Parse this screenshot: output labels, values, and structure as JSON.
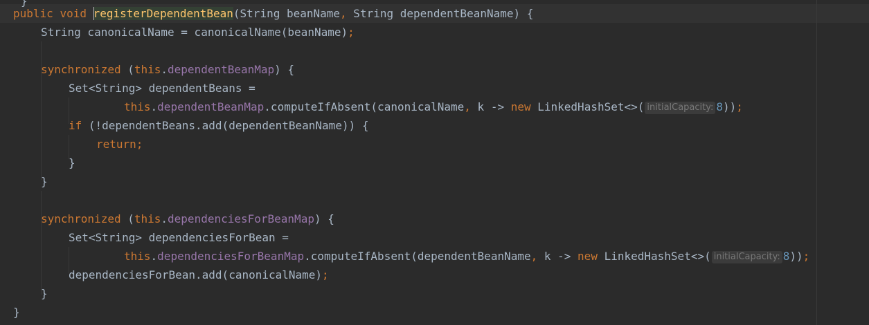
{
  "editor": {
    "top_fragment": "}",
    "line1": {
      "kw_public": "public",
      "kw_void": "void",
      "method_name": "registerDependentBean",
      "params": "(String beanName",
      "comma": ",",
      "params2": " String dependentBeanName) {"
    },
    "line2": {
      "text": "String canonicalName = canonicalName(beanName)",
      "semi": ";"
    },
    "line4": {
      "kw_sync": "synchronized",
      "open": " (",
      "kw_this": "this",
      "dot": ".",
      "field": "dependentBeanMap",
      "close": ") {"
    },
    "line5": {
      "text": "Set<String> dependentBeans ="
    },
    "line6": {
      "kw_this": "this",
      "dot": ".",
      "field": "dependentBeanMap",
      "call": ".computeIfAbsent(canonicalName",
      "comma": ",",
      "lambda": " k -> ",
      "kw_new": "new",
      "ctor": " LinkedHashSet<>(",
      "hint_label": "initialCapacity:",
      "hint_value": "8",
      "end": "))",
      "semi": ";"
    },
    "line7": {
      "kw_if": "if",
      "text": " (!dependentBeans.add(dependentBeanName)) {"
    },
    "line8": {
      "kw_return": "return",
      "semi": ";"
    },
    "line9": {
      "text": "}"
    },
    "line10": {
      "text": "}"
    },
    "line12": {
      "kw_sync": "synchronized",
      "open": " (",
      "kw_this": "this",
      "dot": ".",
      "field": "dependenciesForBeanMap",
      "close": ") {"
    },
    "line13": {
      "text": "Set<String> dependenciesForBean ="
    },
    "line14": {
      "kw_this": "this",
      "dot": ".",
      "field": "dependenciesForBeanMap",
      "call": ".computeIfAbsent(dependentBeanName",
      "comma": ",",
      "lambda": " k -> ",
      "kw_new": "new",
      "ctor": " LinkedHashSet<>(",
      "hint_label": "initialCapacity:",
      "hint_value": "8",
      "end": "))",
      "semi": ";"
    },
    "line15": {
      "text": "dependenciesForBean.add(canonicalName)",
      "semi": ";"
    },
    "line16": {
      "text": "}"
    },
    "line17": {
      "text": "}"
    }
  },
  "colors": {
    "background": "#2b2b2b",
    "keyword": "#cc7832",
    "field": "#9876aa",
    "method": "#ffc66d",
    "number": "#6897bb",
    "text": "#a9b7c6",
    "hint": "#787878"
  }
}
